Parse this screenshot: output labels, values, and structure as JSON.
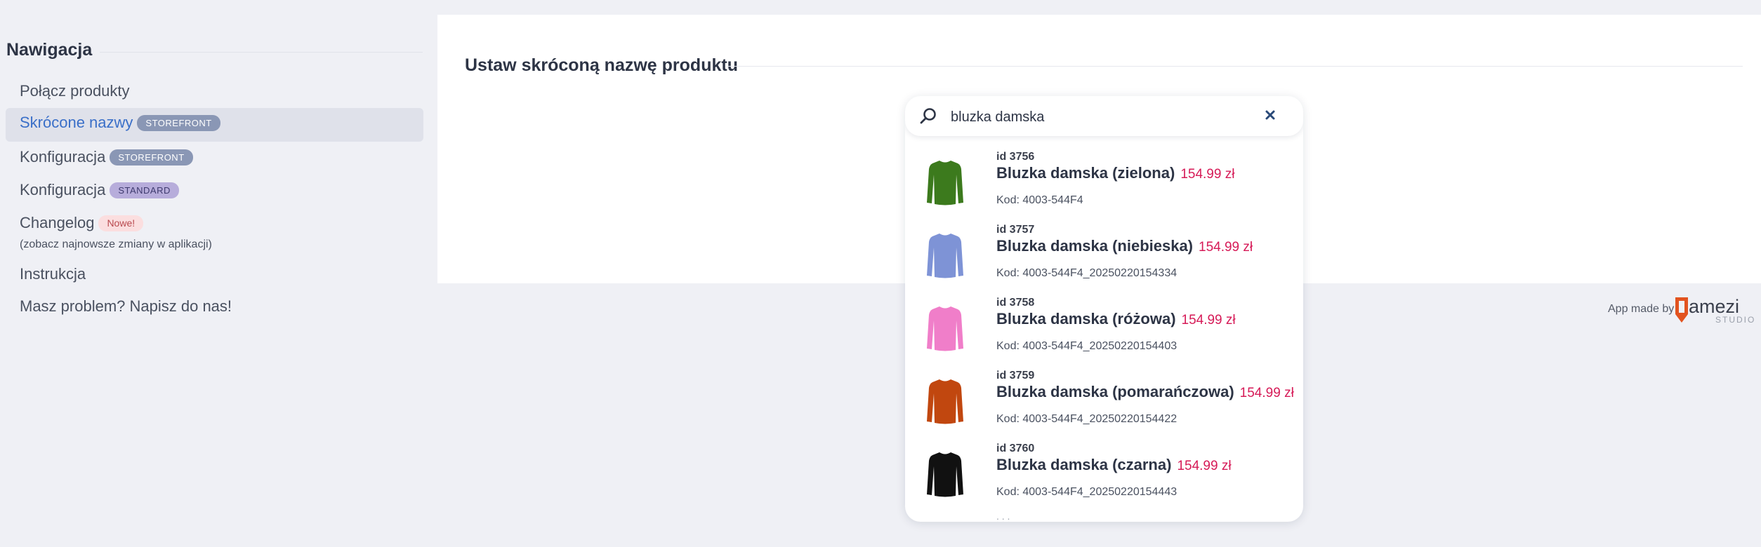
{
  "sidebar": {
    "title": "Nawigacja",
    "items": [
      {
        "label": "Połącz produkty"
      },
      {
        "label": "Skrócone nazwy",
        "badge": "STOREFRONT"
      },
      {
        "label": "Konfiguracja",
        "badge": "STOREFRONT"
      },
      {
        "label": "Konfiguracja",
        "badge": "STANDARD"
      },
      {
        "label": "Changelog",
        "badge": "Nowe!",
        "sub": "(zobacz najnowsze zmiany w aplikacji)"
      },
      {
        "label": "Instrukcja"
      },
      {
        "label": "Masz problem? Napisz do nas!"
      }
    ]
  },
  "main": {
    "title": "Ustaw skróconą nazwę produktu"
  },
  "search": {
    "value": "bluzka damska",
    "icon": "search-icon",
    "clear_icon": "close-icon",
    "results": [
      {
        "id": "id 3756",
        "name": "Bluzka damska (zielona)",
        "price": "154.99 zł",
        "code": "Kod: 4003-544F4",
        "color": "#3c7a1d"
      },
      {
        "id": "id 3757",
        "name": "Bluzka damska (niebieska)",
        "price": "154.99 zł",
        "code": "Kod: 4003-544F4_20250220154334",
        "color": "#7e93d6"
      },
      {
        "id": "id 3758",
        "name": "Bluzka damska (różowa)",
        "price": "154.99 zł",
        "code": "Kod: 4003-544F4_20250220154403",
        "color": "#f07ec9"
      },
      {
        "id": "id 3759",
        "name": "Bluzka damska (pomarańczowa)",
        "price": "154.99 zł",
        "code": "Kod: 4003-544F4_20250220154422",
        "color": "#c1470f"
      },
      {
        "id": "id 3760",
        "name": "Bluzka damska (czarna)",
        "price": "154.99 zł",
        "code": "Kod: 4003-544F4_20250220154443",
        "color": "#111111"
      }
    ],
    "more": ". . ."
  },
  "footer": {
    "made_by": "App made by",
    "brand": "amezi",
    "brand_sub": "STUDIO",
    "brand_color": "#e2531f"
  }
}
